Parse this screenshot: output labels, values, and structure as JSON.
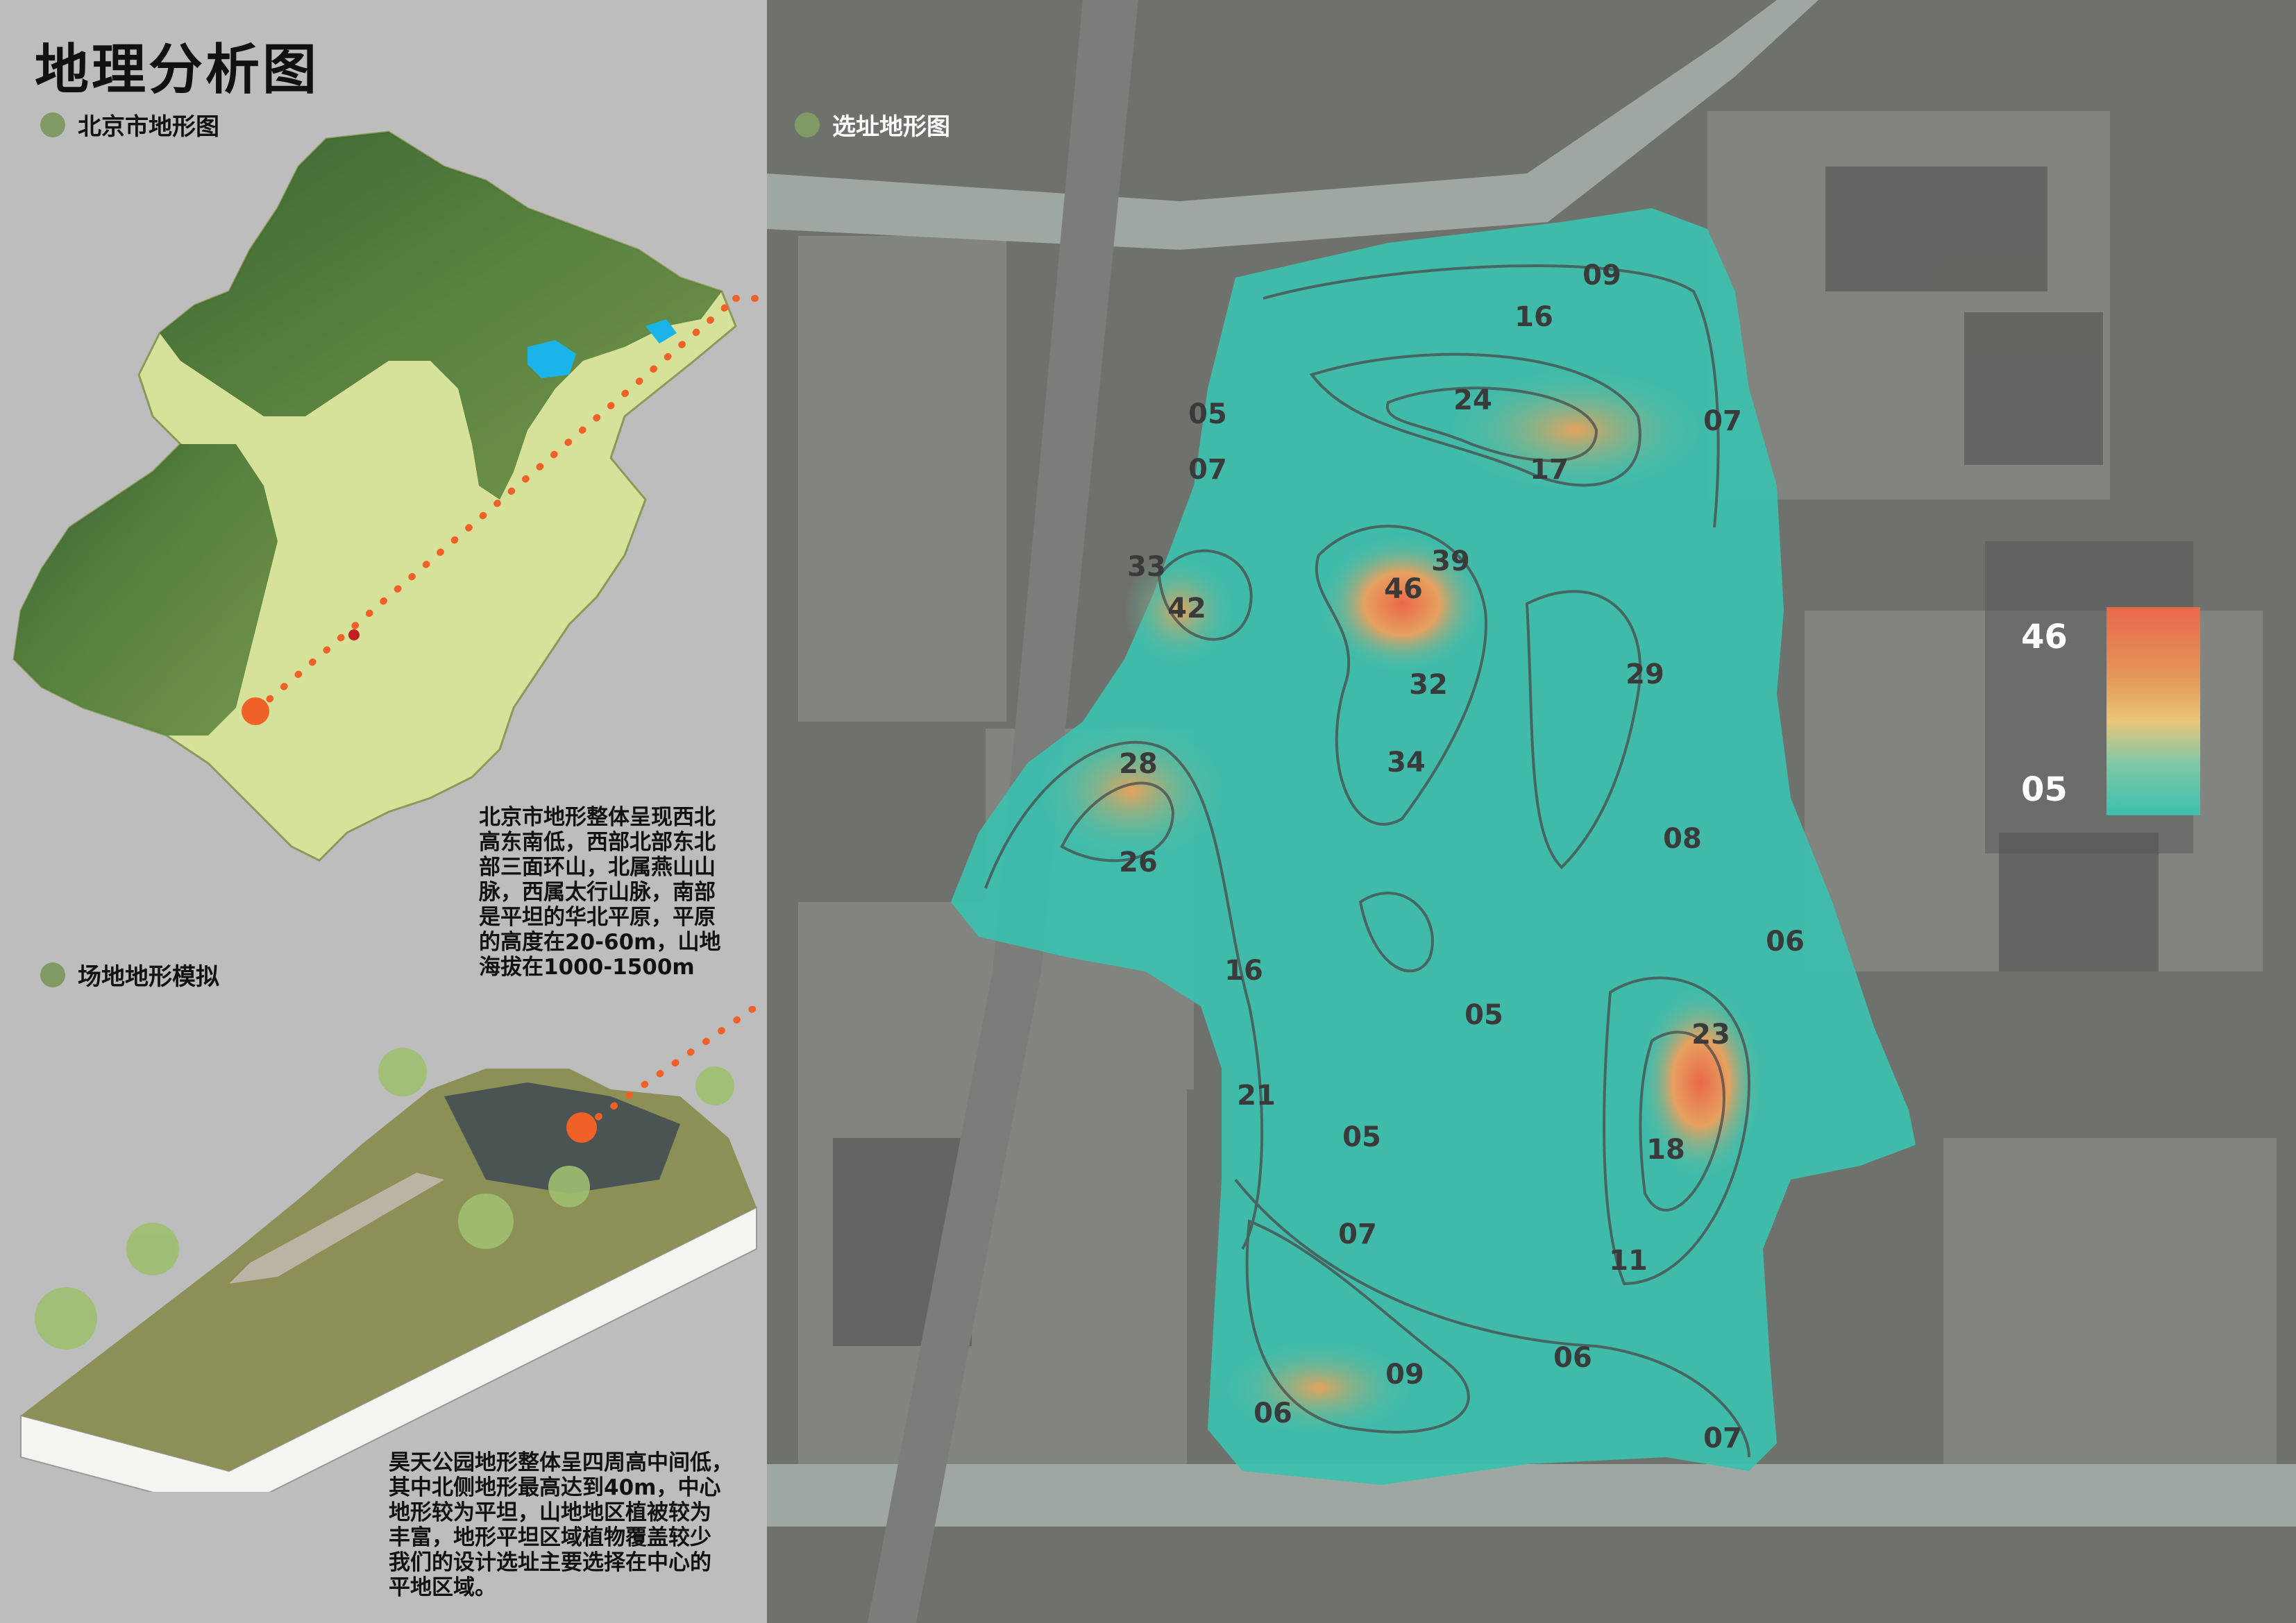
{
  "title": "地理分析图",
  "sections": {
    "beijing_map": "北京市地形图",
    "site_map": "选址地形图",
    "site_model": "场地地形模拟"
  },
  "descriptions": {
    "beijing": "北京市地形整体呈现西北\n高东南低，西部北部东北\n部三面环山，北属燕山山\n脉，西属太行山脉，南部\n是平坦的华北平原，平原\n的高度在20-60m，山地\n海拔在1000-1500m",
    "park": "昊天公园地形整体呈四周高中间低，\n其中北侧地形最高达到40m，中心\n地形较为平坦，山地地区植被较为\n丰富，地形平坦区域植物覆盖较少\n我们的设计选址主要选择在中心的\n平地区域。"
  },
  "legend": {
    "max": "46",
    "min": "05"
  },
  "contour_labels": [
    "09",
    "16",
    "24",
    "05",
    "07",
    "17",
    "07",
    "33",
    "42",
    "46",
    "39",
    "32",
    "29",
    "34",
    "28",
    "26",
    "08",
    "16",
    "06",
    "05",
    "23",
    "21",
    "05",
    "18",
    "07",
    "11",
    "09",
    "06",
    "06",
    "07"
  ],
  "colors": {
    "accent": "#f0612a",
    "terrain_low": "#3dbfae",
    "terrain_high": "#e8674a",
    "bullet": "#7f9a63"
  }
}
